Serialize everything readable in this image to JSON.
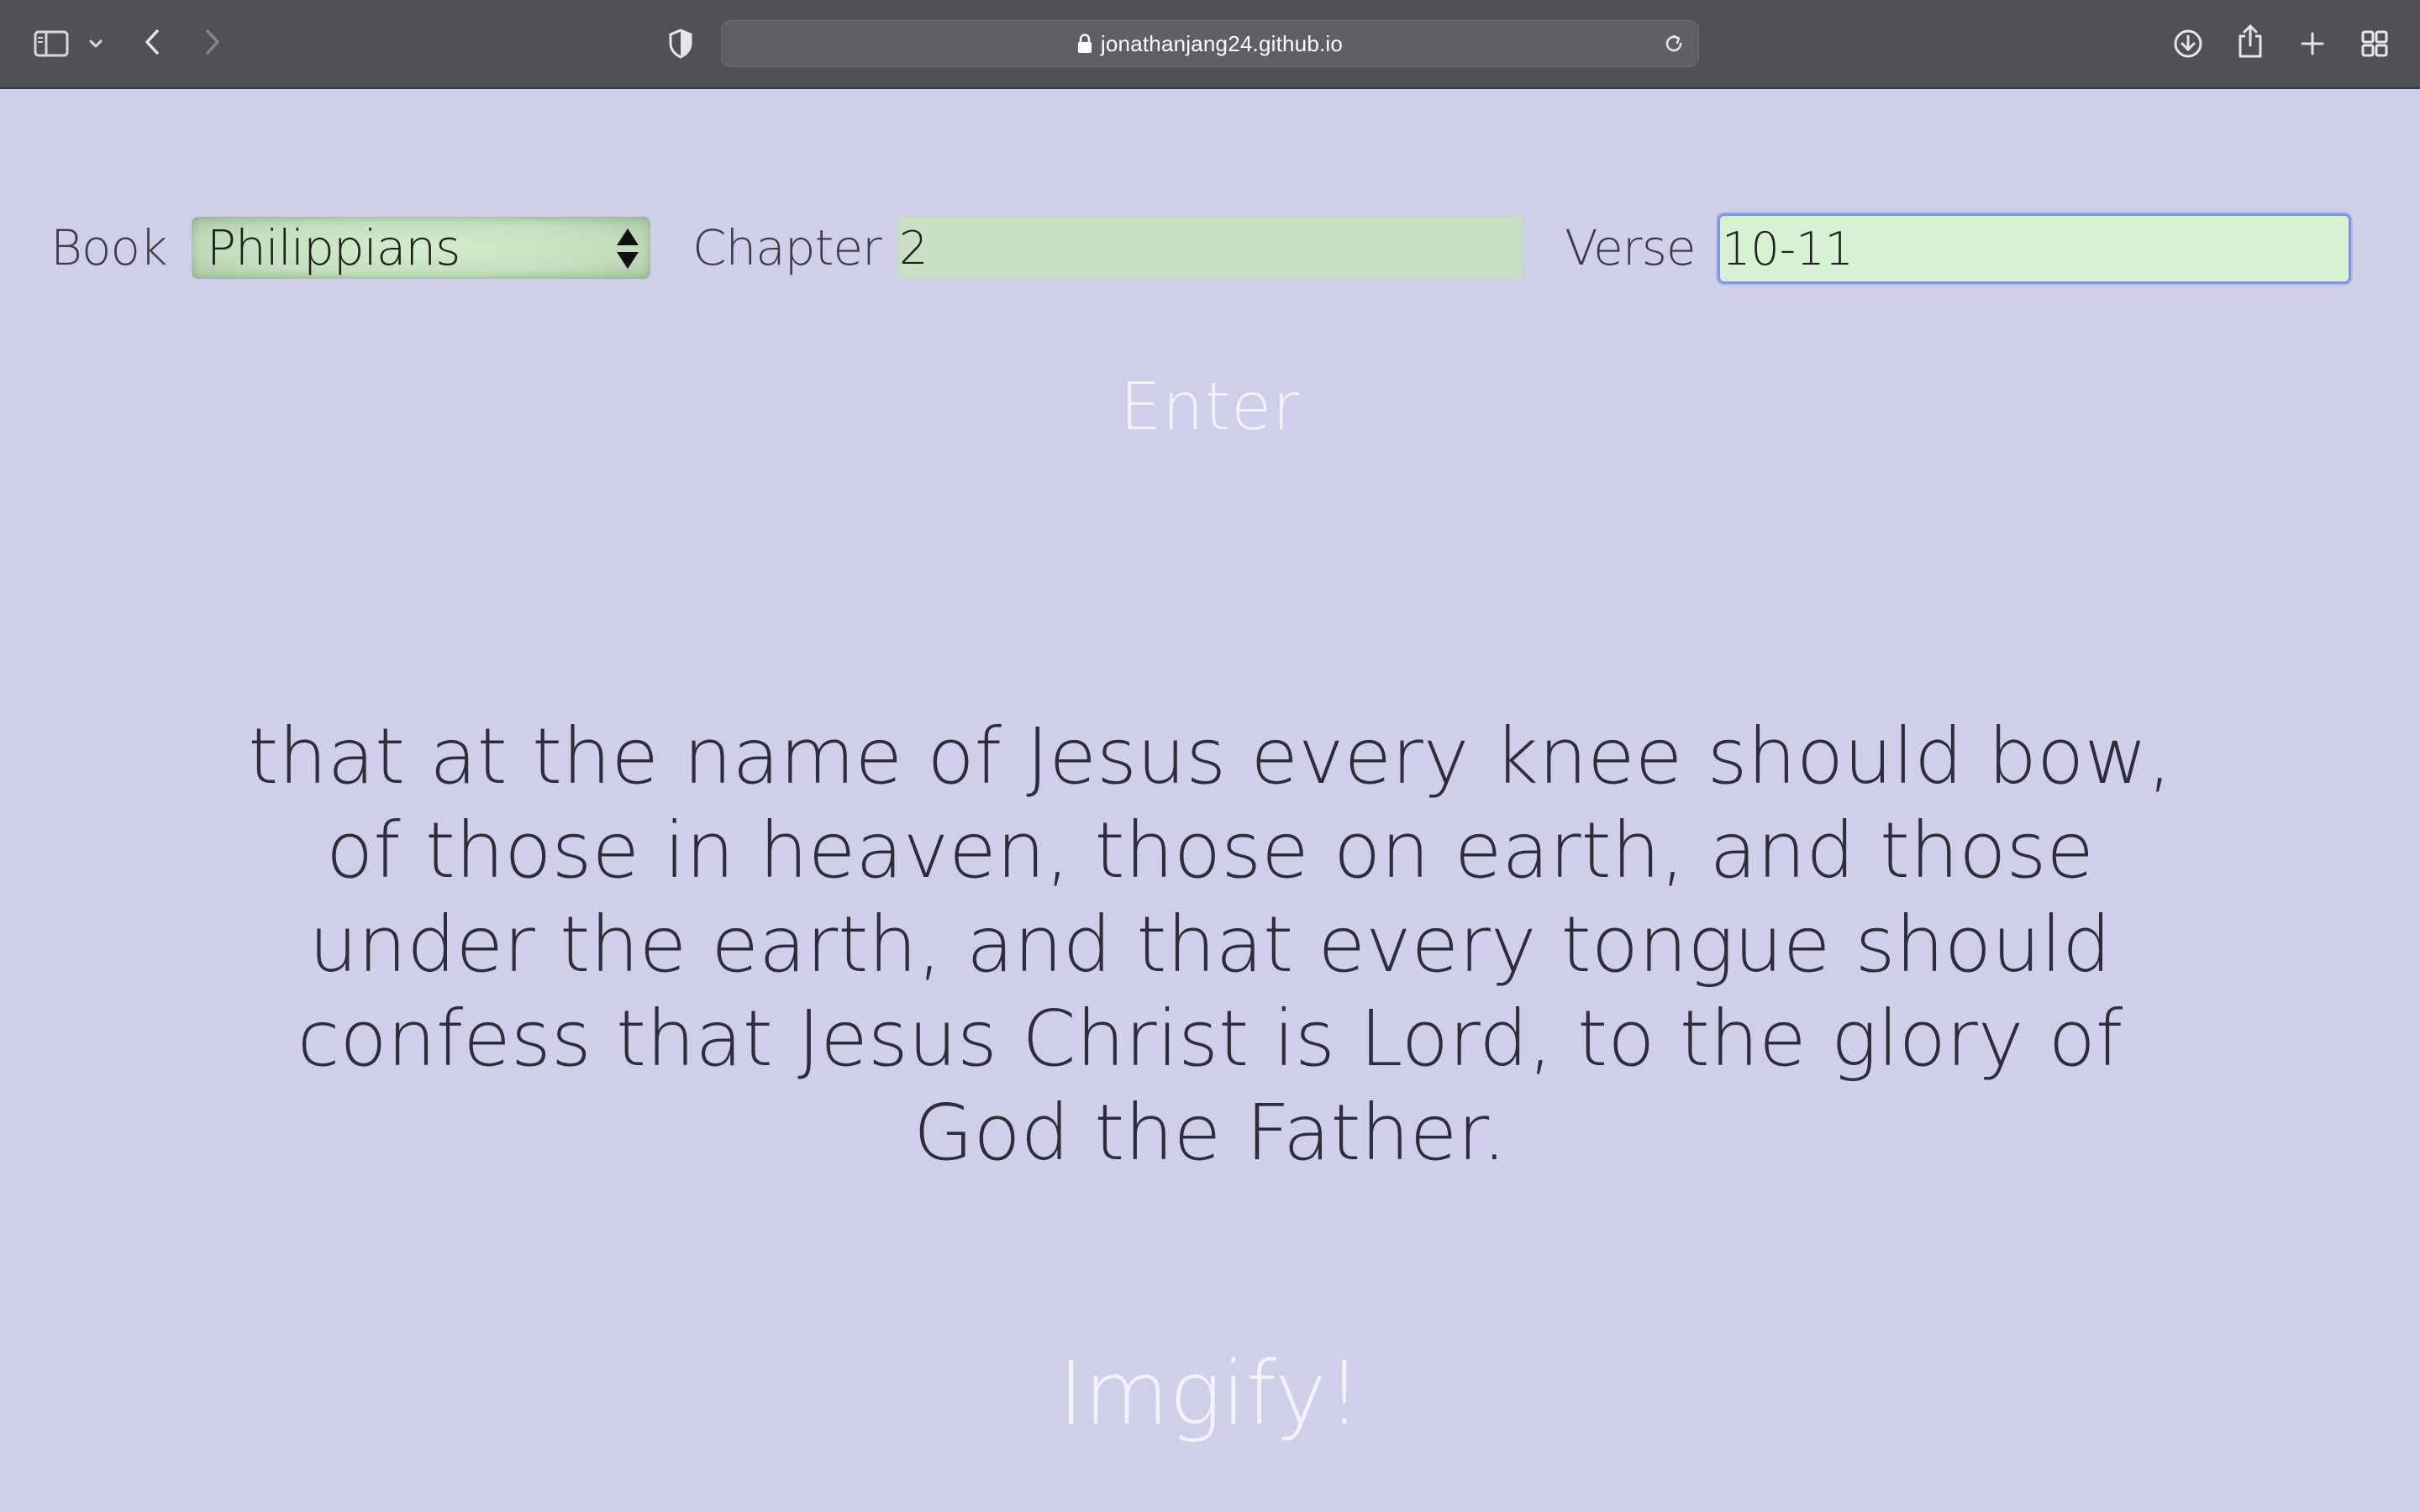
{
  "browser": {
    "url": "jonathanjang24.github.io",
    "icons": {
      "sidebar": "sidebar-icon",
      "sidebar_menu": "chevron-down-icon",
      "back": "back-arrow-icon",
      "forward": "forward-arrow-icon",
      "privacy": "shield-icon",
      "lock": "lock-icon",
      "reload": "reload-icon",
      "downloads": "download-icon",
      "share": "share-icon",
      "new_tab": "plus-icon",
      "tab_overview": "grid-icon"
    }
  },
  "form": {
    "book_label": "Book",
    "book_value": "Philippians",
    "chapter_label": "Chapter",
    "chapter_value": "2",
    "verse_label": "Verse",
    "verse_value": "10-11"
  },
  "enter_label": "Enter",
  "verse_text": "that at the name of Jesus every knee should bow, of those in heaven, those on earth, and those under the earth, and that every tongue should confess that Jesus Christ is Lord, to the glory of God the Father.",
  "imgify_label": "Imgify!",
  "colors": {
    "page_background": "#d0cfea",
    "toolbar": "#505057",
    "input_green": "#c9e0c5",
    "focused_input": "#d6f2d2",
    "focus_ring": "#7e95e6",
    "button_text": "#f3f2fb"
  }
}
